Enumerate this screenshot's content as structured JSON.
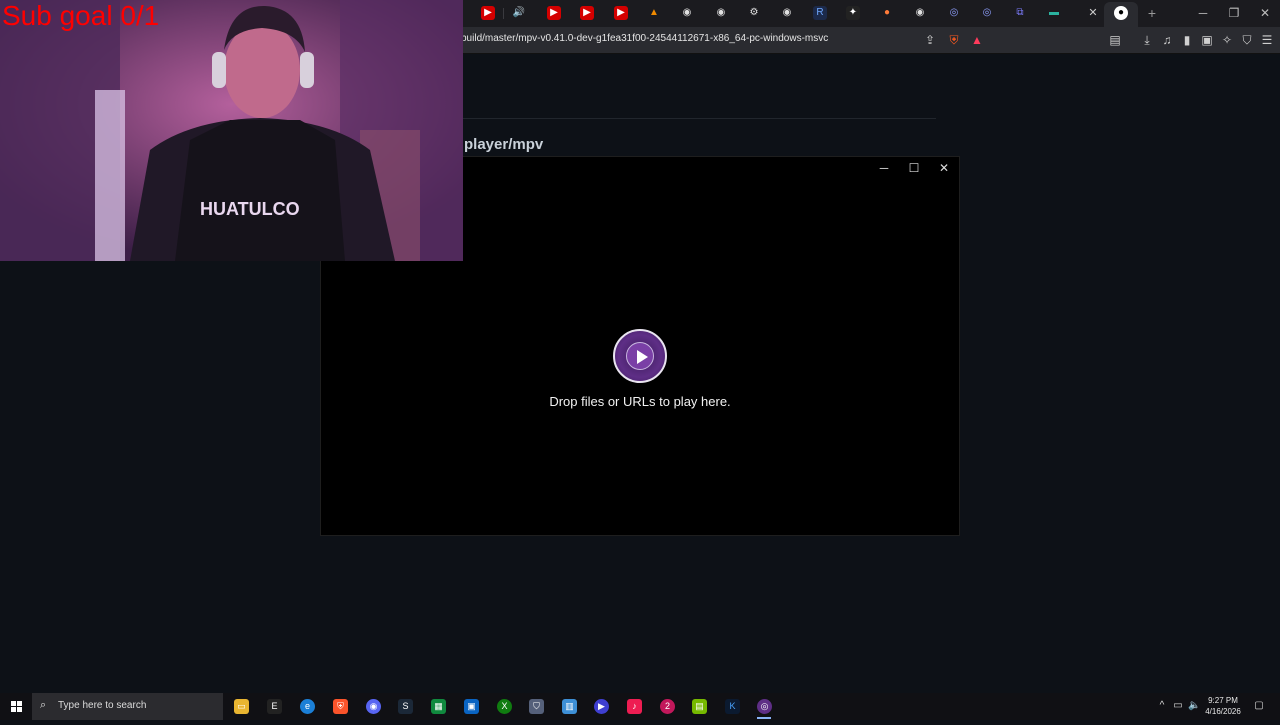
{
  "browser": {
    "url": "build/master/mpv-v0.41.0-dev-g1fea31f00-24544112671-x86_64-pc-windows-msvc",
    "new_tab_label": "+",
    "window_controls": {
      "minimize": "─",
      "maximize": "❐",
      "close": "✕"
    }
  },
  "page": {
    "repo_title": "player/mpv"
  },
  "mpv": {
    "hint": "Drop files or URLs to play here.",
    "controls": {
      "minimize": "─",
      "maximize": "☐",
      "close": "✕"
    }
  },
  "overlay": {
    "sub_goal": "Sub goal 0/1"
  },
  "taskbar": {
    "search_placeholder": "Type here to search",
    "time": "9:27 PM",
    "date": "4/16/2026"
  },
  "colors": {
    "accent_red": "#ff0000",
    "mpv_purple": "#5e2e86",
    "page_bg": "#0d1117"
  }
}
